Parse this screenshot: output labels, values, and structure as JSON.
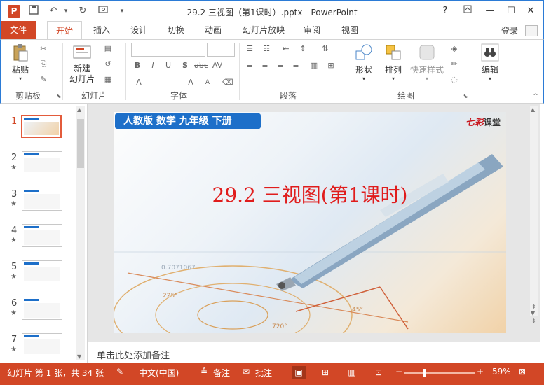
{
  "window": {
    "title": "29.2 三视图（第1课时）.pptx - PowerPoint",
    "help_icon": "?",
    "controls": [
      "?",
      "restore-ribbon",
      "minimize",
      "maximize",
      "close"
    ]
  },
  "ribbon_tabs": [
    "文件",
    "开始",
    "插入",
    "设计",
    "切换",
    "动画",
    "幻灯片放映",
    "审阅",
    "视图"
  ],
  "active_tab": "开始",
  "login": "登录",
  "groups": {
    "clipboard": {
      "paste": "粘贴",
      "label": "剪贴板"
    },
    "slides": {
      "new_slide": "新建\n幻灯片",
      "label": "幻灯片"
    },
    "font": {
      "label": "字体"
    },
    "paragraph": {
      "label": "段落"
    },
    "drawing": {
      "shapes": "形状",
      "arrange": "排列",
      "quick_styles": "快速样式",
      "label": "绘图"
    },
    "editing": {
      "edit": "编辑"
    }
  },
  "thumbnails": [
    {
      "num": "1",
      "star": false
    },
    {
      "num": "2",
      "star": true
    },
    {
      "num": "3",
      "star": true
    },
    {
      "num": "4",
      "star": true
    },
    {
      "num": "5",
      "star": true
    },
    {
      "num": "6",
      "star": true
    },
    {
      "num": "7",
      "star": true
    }
  ],
  "star_glyph": "★",
  "slide": {
    "banner": "人教版 数学 九年级 下册",
    "brand_script": "七彩",
    "brand_word": "课堂",
    "title": "29.2 三视图(第1课时)",
    "figure_numbers": [
      "0.7071067",
      "225°",
      "45°",
      "720°"
    ]
  },
  "notes_placeholder": "单击此处添加备注",
  "status": {
    "slide_info": "幻灯片 第 1 张，共 34 张",
    "language": "中文(中国)",
    "notes": "备注",
    "comments": "批注",
    "zoom": "59%"
  },
  "colors": {
    "accent": "#d24726",
    "title_red": "#e01c1c",
    "banner_blue": "#1d6fc9"
  }
}
